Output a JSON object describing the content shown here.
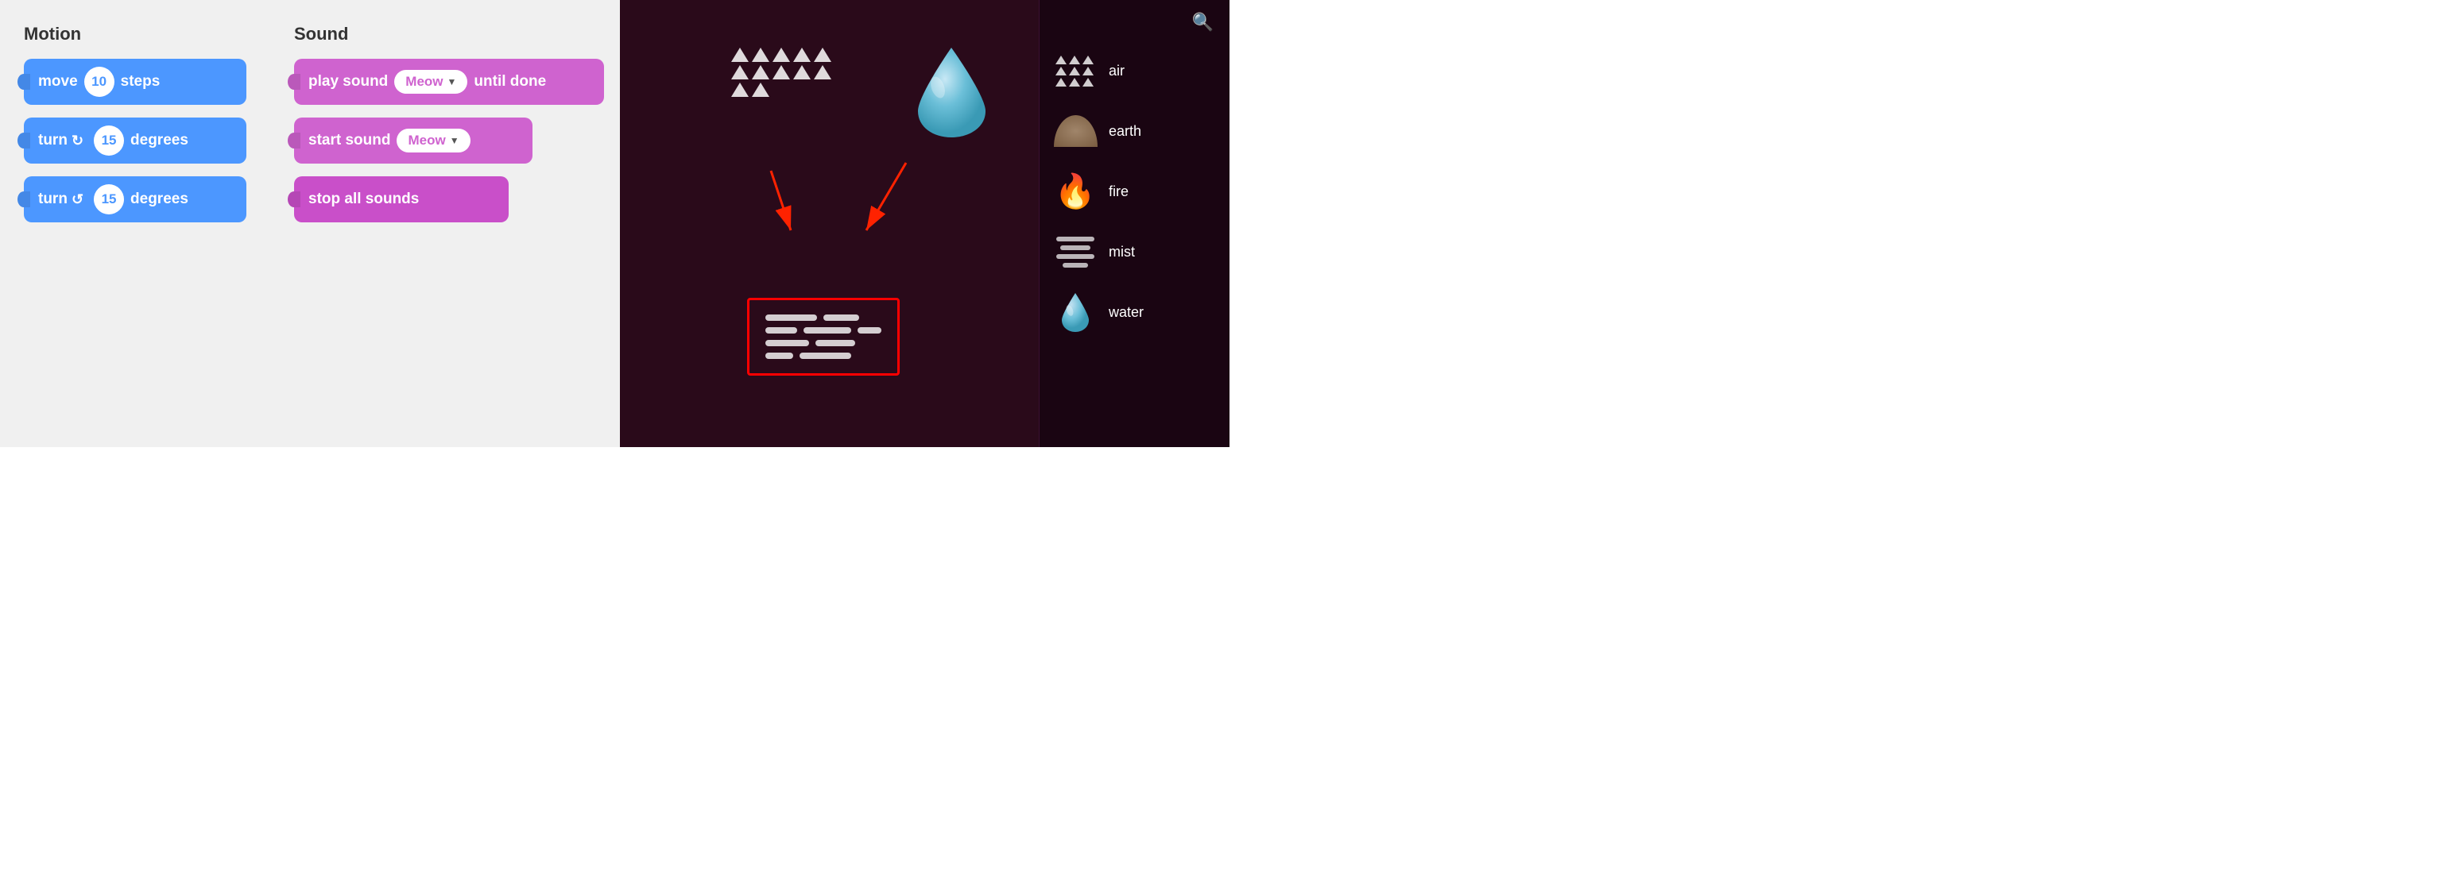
{
  "leftPanel": {
    "motion": {
      "title": "Motion",
      "blocks": [
        {
          "text_pre": "move",
          "value": "10",
          "text_post": "steps"
        },
        {
          "text_pre": "turn",
          "icon": "↻",
          "value": "15",
          "text_post": "degrees"
        },
        {
          "text_pre": "turn",
          "icon": "↺",
          "value": "15",
          "text_post": "degrees"
        }
      ]
    },
    "sound": {
      "title": "Sound",
      "blocks": [
        {
          "type": "long",
          "text_pre": "play sound",
          "dropdown": "Meow",
          "text_post": "until done"
        },
        {
          "type": "medium",
          "text_pre": "start sound",
          "dropdown": "Meow"
        },
        {
          "type": "short",
          "text": "stop all sounds"
        }
      ]
    }
  },
  "rightPanel": {
    "sprites": [
      {
        "name": "air",
        "type": "air"
      },
      {
        "name": "earth",
        "type": "earth"
      },
      {
        "name": "fire",
        "type": "fire"
      },
      {
        "name": "mist",
        "type": "mist"
      },
      {
        "name": "water",
        "type": "water"
      }
    ]
  },
  "colors": {
    "motionBlock": "#4C97FF",
    "soundBlockLight": "#CF63CF",
    "soundBlockDark": "#C94FC9",
    "rightBg": "#2a0a1a",
    "spritePanelBg": "#1a0512"
  }
}
